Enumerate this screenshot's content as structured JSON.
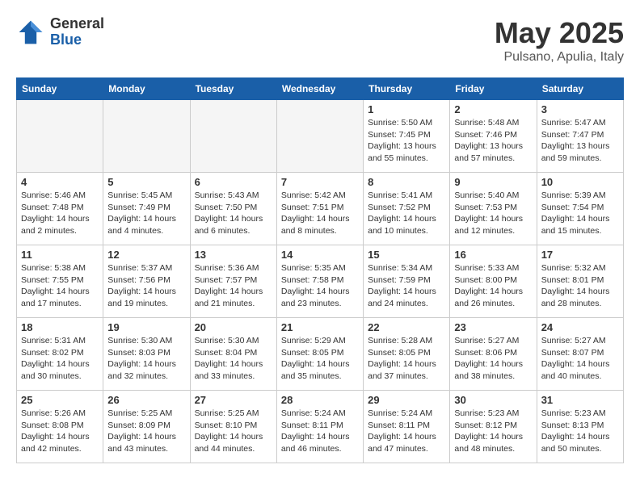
{
  "logo": {
    "general": "General",
    "blue": "Blue"
  },
  "title": "May 2025",
  "subtitle": "Pulsano, Apulia, Italy",
  "days_of_week": [
    "Sunday",
    "Monday",
    "Tuesday",
    "Wednesday",
    "Thursday",
    "Friday",
    "Saturday"
  ],
  "weeks": [
    [
      {
        "num": "",
        "empty": true
      },
      {
        "num": "",
        "empty": true
      },
      {
        "num": "",
        "empty": true
      },
      {
        "num": "",
        "empty": true
      },
      {
        "num": "1",
        "sunrise": "5:50 AM",
        "sunset": "7:45 PM",
        "daylight": "13 hours and 55 minutes."
      },
      {
        "num": "2",
        "sunrise": "5:48 AM",
        "sunset": "7:46 PM",
        "daylight": "13 hours and 57 minutes."
      },
      {
        "num": "3",
        "sunrise": "5:47 AM",
        "sunset": "7:47 PM",
        "daylight": "13 hours and 59 minutes."
      }
    ],
    [
      {
        "num": "4",
        "sunrise": "5:46 AM",
        "sunset": "7:48 PM",
        "daylight": "14 hours and 2 minutes."
      },
      {
        "num": "5",
        "sunrise": "5:45 AM",
        "sunset": "7:49 PM",
        "daylight": "14 hours and 4 minutes."
      },
      {
        "num": "6",
        "sunrise": "5:43 AM",
        "sunset": "7:50 PM",
        "daylight": "14 hours and 6 minutes."
      },
      {
        "num": "7",
        "sunrise": "5:42 AM",
        "sunset": "7:51 PM",
        "daylight": "14 hours and 8 minutes."
      },
      {
        "num": "8",
        "sunrise": "5:41 AM",
        "sunset": "7:52 PM",
        "daylight": "14 hours and 10 minutes."
      },
      {
        "num": "9",
        "sunrise": "5:40 AM",
        "sunset": "7:53 PM",
        "daylight": "14 hours and 12 minutes."
      },
      {
        "num": "10",
        "sunrise": "5:39 AM",
        "sunset": "7:54 PM",
        "daylight": "14 hours and 15 minutes."
      }
    ],
    [
      {
        "num": "11",
        "sunrise": "5:38 AM",
        "sunset": "7:55 PM",
        "daylight": "14 hours and 17 minutes."
      },
      {
        "num": "12",
        "sunrise": "5:37 AM",
        "sunset": "7:56 PM",
        "daylight": "14 hours and 19 minutes."
      },
      {
        "num": "13",
        "sunrise": "5:36 AM",
        "sunset": "7:57 PM",
        "daylight": "14 hours and 21 minutes."
      },
      {
        "num": "14",
        "sunrise": "5:35 AM",
        "sunset": "7:58 PM",
        "daylight": "14 hours and 23 minutes."
      },
      {
        "num": "15",
        "sunrise": "5:34 AM",
        "sunset": "7:59 PM",
        "daylight": "14 hours and 24 minutes."
      },
      {
        "num": "16",
        "sunrise": "5:33 AM",
        "sunset": "8:00 PM",
        "daylight": "14 hours and 26 minutes."
      },
      {
        "num": "17",
        "sunrise": "5:32 AM",
        "sunset": "8:01 PM",
        "daylight": "14 hours and 28 minutes."
      }
    ],
    [
      {
        "num": "18",
        "sunrise": "5:31 AM",
        "sunset": "8:02 PM",
        "daylight": "14 hours and 30 minutes."
      },
      {
        "num": "19",
        "sunrise": "5:30 AM",
        "sunset": "8:03 PM",
        "daylight": "14 hours and 32 minutes."
      },
      {
        "num": "20",
        "sunrise": "5:30 AM",
        "sunset": "8:04 PM",
        "daylight": "14 hours and 33 minutes."
      },
      {
        "num": "21",
        "sunrise": "5:29 AM",
        "sunset": "8:05 PM",
        "daylight": "14 hours and 35 minutes."
      },
      {
        "num": "22",
        "sunrise": "5:28 AM",
        "sunset": "8:05 PM",
        "daylight": "14 hours and 37 minutes."
      },
      {
        "num": "23",
        "sunrise": "5:27 AM",
        "sunset": "8:06 PM",
        "daylight": "14 hours and 38 minutes."
      },
      {
        "num": "24",
        "sunrise": "5:27 AM",
        "sunset": "8:07 PM",
        "daylight": "14 hours and 40 minutes."
      }
    ],
    [
      {
        "num": "25",
        "sunrise": "5:26 AM",
        "sunset": "8:08 PM",
        "daylight": "14 hours and 42 minutes."
      },
      {
        "num": "26",
        "sunrise": "5:25 AM",
        "sunset": "8:09 PM",
        "daylight": "14 hours and 43 minutes."
      },
      {
        "num": "27",
        "sunrise": "5:25 AM",
        "sunset": "8:10 PM",
        "daylight": "14 hours and 44 minutes."
      },
      {
        "num": "28",
        "sunrise": "5:24 AM",
        "sunset": "8:11 PM",
        "daylight": "14 hours and 46 minutes."
      },
      {
        "num": "29",
        "sunrise": "5:24 AM",
        "sunset": "8:11 PM",
        "daylight": "14 hours and 47 minutes."
      },
      {
        "num": "30",
        "sunrise": "5:23 AM",
        "sunset": "8:12 PM",
        "daylight": "14 hours and 48 minutes."
      },
      {
        "num": "31",
        "sunrise": "5:23 AM",
        "sunset": "8:13 PM",
        "daylight": "14 hours and 50 minutes."
      }
    ]
  ],
  "labels": {
    "sunrise": "Sunrise:",
    "sunset": "Sunset:",
    "daylight": "Daylight:"
  }
}
